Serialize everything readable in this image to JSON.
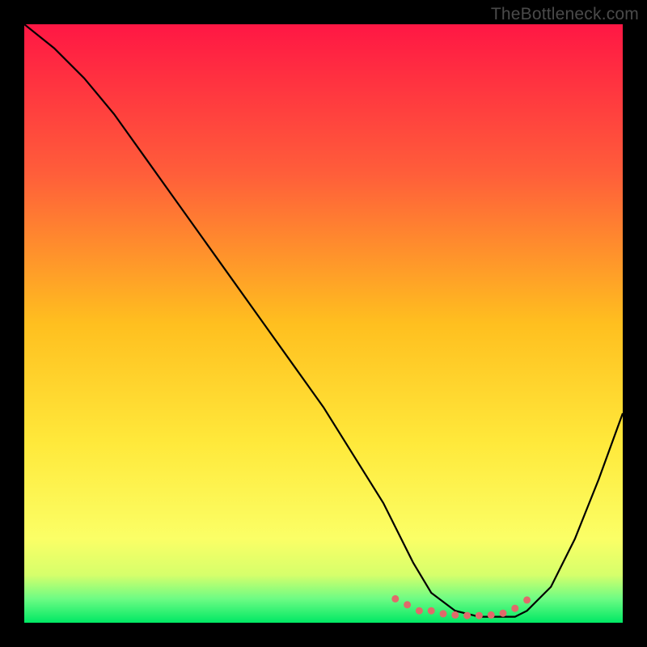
{
  "watermark": "TheBottleneck.com",
  "chart_data": {
    "type": "line",
    "title": "",
    "xlabel": "",
    "ylabel": "",
    "xlim": [
      0,
      100
    ],
    "ylim": [
      0,
      100
    ],
    "gradient_stops": [
      {
        "offset": 0.0,
        "color": "#ff1744"
      },
      {
        "offset": 0.25,
        "color": "#ff5e3a"
      },
      {
        "offset": 0.5,
        "color": "#ffbf1f"
      },
      {
        "offset": 0.7,
        "color": "#ffe93b"
      },
      {
        "offset": 0.86,
        "color": "#fbff66"
      },
      {
        "offset": 0.92,
        "color": "#d6ff6b"
      },
      {
        "offset": 0.96,
        "color": "#6dfc84"
      },
      {
        "offset": 1.0,
        "color": "#00e864"
      }
    ],
    "series": [
      {
        "name": "curve",
        "x": [
          0,
          5,
          10,
          15,
          20,
          25,
          30,
          35,
          40,
          45,
          50,
          55,
          60,
          62,
          65,
          68,
          72,
          76,
          80,
          82,
          84,
          88,
          92,
          96,
          100
        ],
        "y": [
          100,
          96,
          91,
          85,
          78,
          71,
          64,
          57,
          50,
          43,
          36,
          28,
          20,
          16,
          10,
          5,
          2,
          1,
          1,
          1,
          2,
          6,
          14,
          24,
          35
        ]
      }
    ],
    "marker_points": {
      "x": [
        62,
        64,
        66,
        68,
        70,
        72,
        74,
        76,
        78,
        80,
        82,
        84
      ],
      "y": [
        4,
        3,
        2,
        2,
        1.5,
        1.3,
        1.2,
        1.2,
        1.3,
        1.6,
        2.4,
        3.8
      ]
    }
  }
}
